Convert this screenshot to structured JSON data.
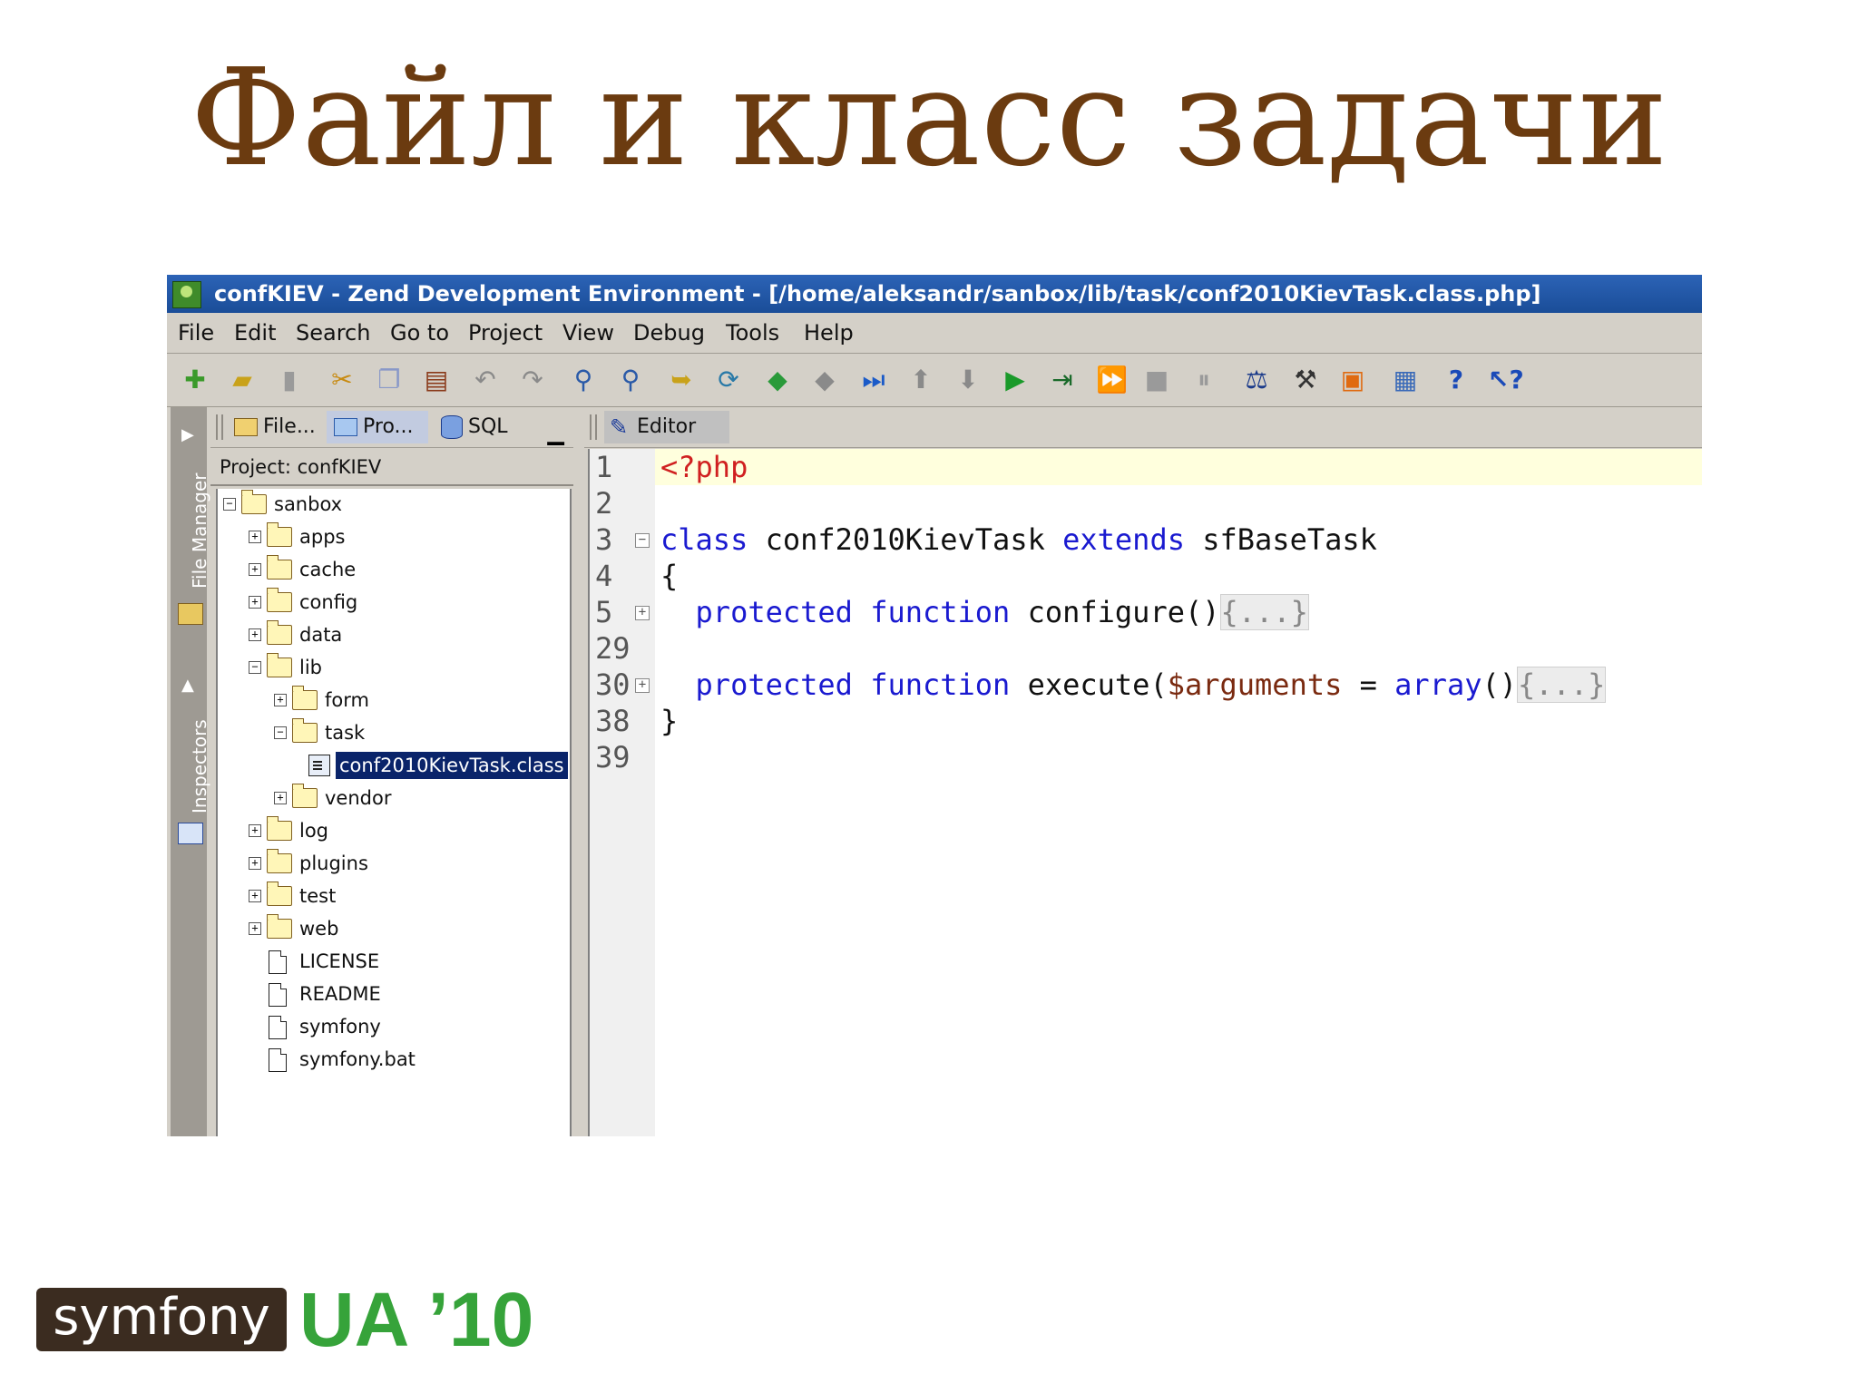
{
  "slide": {
    "title": "Файл и класс задачи"
  },
  "window": {
    "title": "confKIEV - Zend Development Environment - [/home/aleksandr/sanbox/lib/task/conf2010KievTask.class.php]"
  },
  "menu": {
    "items": [
      "File",
      "Edit",
      "Search",
      "Go to",
      "Project",
      "View",
      "Debug",
      "Tools",
      "Help"
    ]
  },
  "toolbar": {
    "icons": [
      "new-file-icon",
      "open-file-icon",
      "save-icon",
      "cut-icon",
      "copy-icon",
      "paste-icon",
      "undo-icon",
      "redo-icon",
      "find-icon",
      "replace-icon",
      "goto-icon",
      "refresh-icon",
      "back-icon",
      "forward-icon",
      "run-debug-icon",
      "step-up-icon",
      "step-down-icon",
      "play-icon",
      "step-icon",
      "fast-forward-icon",
      "stop-icon",
      "pause-icon",
      "profile-icon",
      "tools-icon",
      "package-icon",
      "calendar-icon",
      "help-icon",
      "context-help-icon"
    ]
  },
  "side_strip": {
    "file_manager": "File Manager",
    "inspectors": "Inspectors"
  },
  "left_panel": {
    "tabs": [
      "File...",
      "Pro...",
      "SQL"
    ],
    "project_label": "Project: confKIEV",
    "tree": [
      "sanbox",
      "apps",
      "cache",
      "config",
      "data",
      "lib",
      "form",
      "task",
      "conf2010KievTask.class",
      "vendor",
      "log",
      "plugins",
      "test",
      "web",
      "LICENSE",
      "README",
      "symfony",
      "symfony.bat"
    ]
  },
  "editor": {
    "tab": "Editor",
    "line_numbers": [
      "1",
      "2",
      "3",
      "4",
      "5",
      "29",
      "30",
      "38",
      "39"
    ],
    "code": {
      "php_open": "<?php",
      "kw_class": "class",
      "class_name": " conf2010KievTask ",
      "kw_extends": "extends",
      "parent": " sfBaseTask",
      "open_brace": "{",
      "kw_protected": "protected",
      "kw_function": "function",
      "configure": " configure()",
      "collapsed": "{...}",
      "execute": " execute(",
      "arg": "$arguments",
      "equals": " = ",
      "kw_array": "array",
      "parens": "()",
      "close_brace": "}"
    }
  },
  "logo": {
    "brand": "symfony",
    "event": "UA ’10"
  },
  "colors": {
    "title": "#6b3b10",
    "titlebar": "#1a4d98",
    "selection": "#0a246a",
    "keyword": "#1a1ad0",
    "php_tag": "#d02020",
    "logo_green": "#36a33a"
  }
}
